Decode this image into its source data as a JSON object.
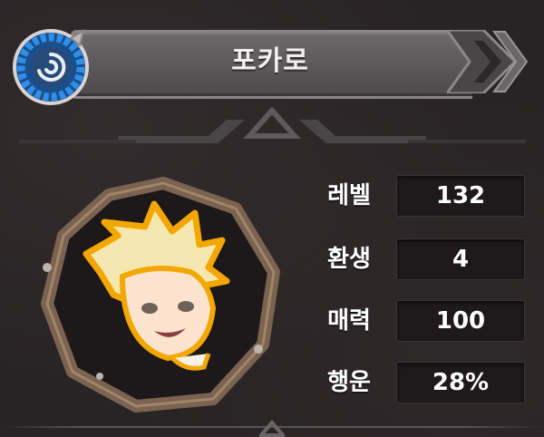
{
  "character": {
    "name": "포카로"
  },
  "stats": [
    {
      "label": "레벨",
      "value": "132"
    },
    {
      "label": "환생",
      "value": "4"
    },
    {
      "label": "매력",
      "value": "100"
    },
    {
      "label": "행운",
      "value": "28%"
    }
  ],
  "colors": {
    "background": "#2a2526",
    "title_plate": "#5a5657",
    "emblem_blue": "#2f8ee6",
    "frame_wood": "#7a6350",
    "stat_box": "#1e1a1b",
    "text": "#ffffff"
  },
  "icons": {
    "emblem": "guild-emblem-icon",
    "chevron": "chevron-right-icon"
  }
}
